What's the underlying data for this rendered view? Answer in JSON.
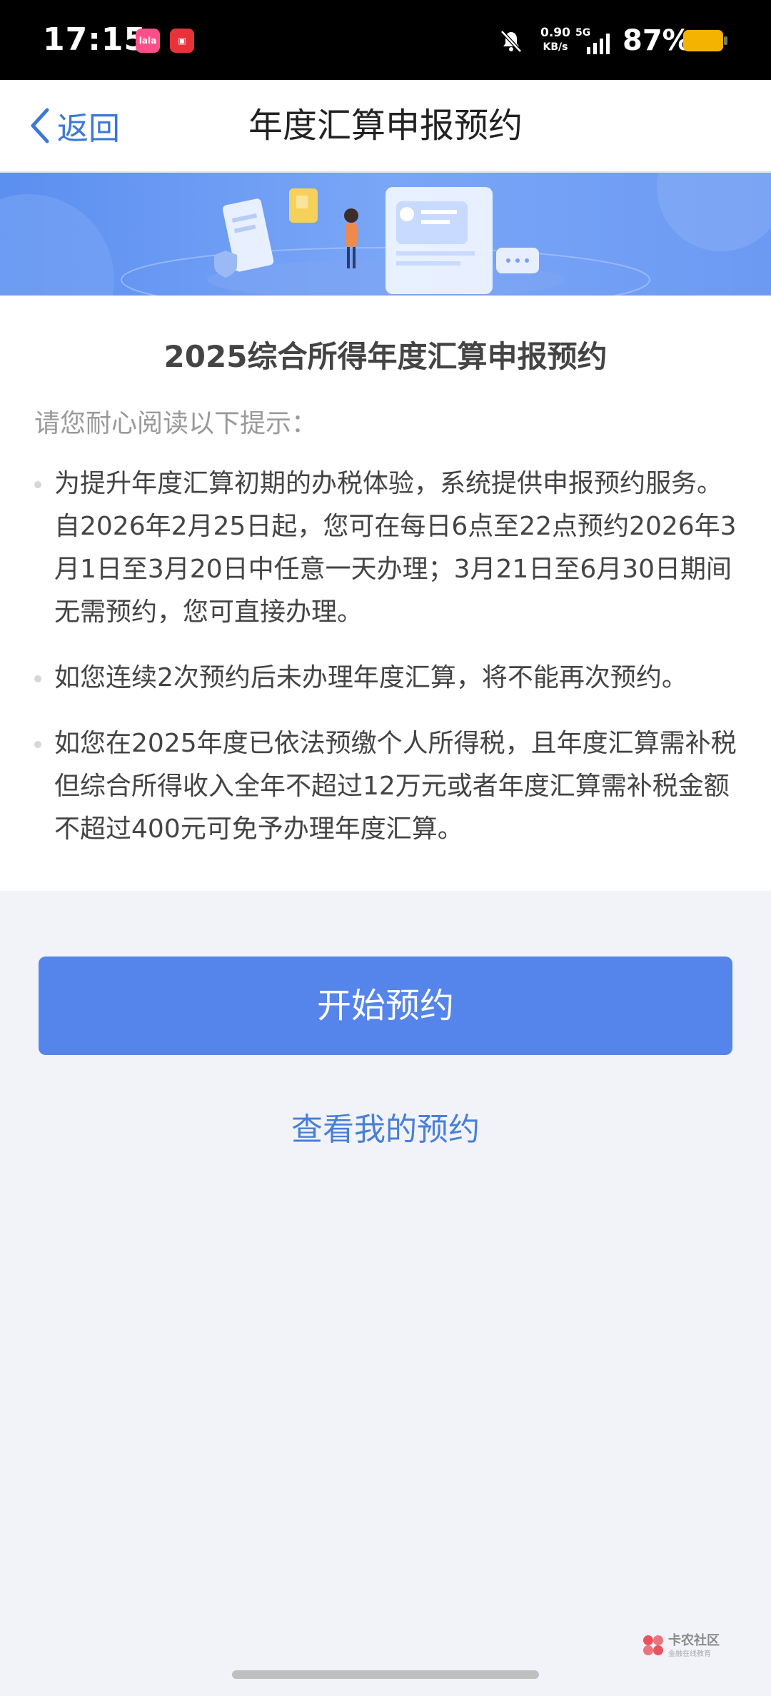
{
  "status_bar": {
    "time": "17:15",
    "net_speed_value": "0.90",
    "net_speed_unit": "KB/s",
    "network": "5G",
    "battery": "87%",
    "icons": [
      "app-badge-icon",
      "app-badge-icon",
      "bell-muted-icon",
      "signal-icon",
      "battery-icon"
    ],
    "battery_color": "#f5b301"
  },
  "nav": {
    "back_label": "返回",
    "title": "年度汇算申报预约"
  },
  "card": {
    "title": "2025综合所得年度汇算申报预约",
    "subtitle": "请您耐心阅读以下提示：",
    "tips": [
      "为提升年度汇算初期的办税体验，系统提供申报预约服务。自2026年2月25日起，您可在每日6点至22点预约2026年3月1日至3月20日中任意一天办理；3月21日至6月30日期间无需预约，您可直接办理。",
      "如您连续2次预约后未办理年度汇算，将不能再次预约。",
      "如您在2025年度已依法预缴个人所得税，且年度汇算需补税但综合所得收入全年不超过12万元或者年度汇算需补税金额不超过400元可免予办理年度汇算。"
    ]
  },
  "actions": {
    "primary_label": "开始预约",
    "secondary_label": "查看我的预约"
  },
  "watermark": {
    "name": "卡农社区",
    "sub": "金融在线教育"
  },
  "colors": {
    "accent": "#5585ea",
    "link": "#4a7fd6",
    "page_bg": "#f2f3f8"
  }
}
